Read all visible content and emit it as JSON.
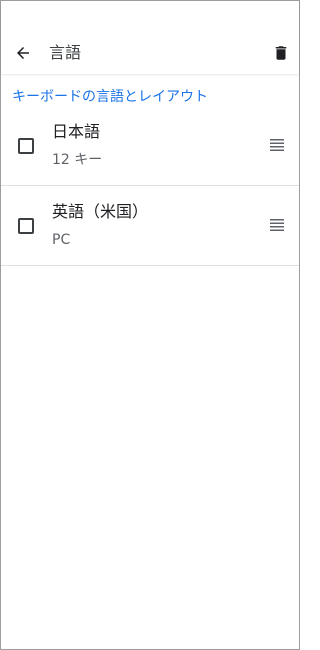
{
  "header": {
    "title": "言語",
    "back_icon": "arrow-back-icon",
    "delete_icon": "trash-icon"
  },
  "section": {
    "label": "キーボードの言語とレイアウト",
    "color": "#1a73e8"
  },
  "languages": [
    {
      "title": "日本語",
      "subtitle": "12 キー",
      "checked": false
    },
    {
      "title": "英語（米国）",
      "subtitle": "PC",
      "checked": false
    }
  ],
  "icons": {
    "drag": "drag-handle-icon",
    "checkbox": "checkbox-icon"
  }
}
